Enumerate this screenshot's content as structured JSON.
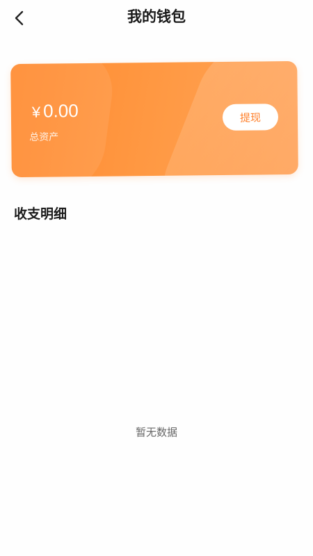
{
  "header": {
    "title": "我的钱包",
    "back_icon": "chevron-left-icon"
  },
  "wallet_card": {
    "currency_symbol": "¥",
    "balance": "0.00",
    "balance_label": "总资产",
    "withdraw_label": "提现",
    "accent_color": "#ff8a2f"
  },
  "transactions": {
    "section_title": "收支明细",
    "empty_text": "暂无数据",
    "items": []
  }
}
